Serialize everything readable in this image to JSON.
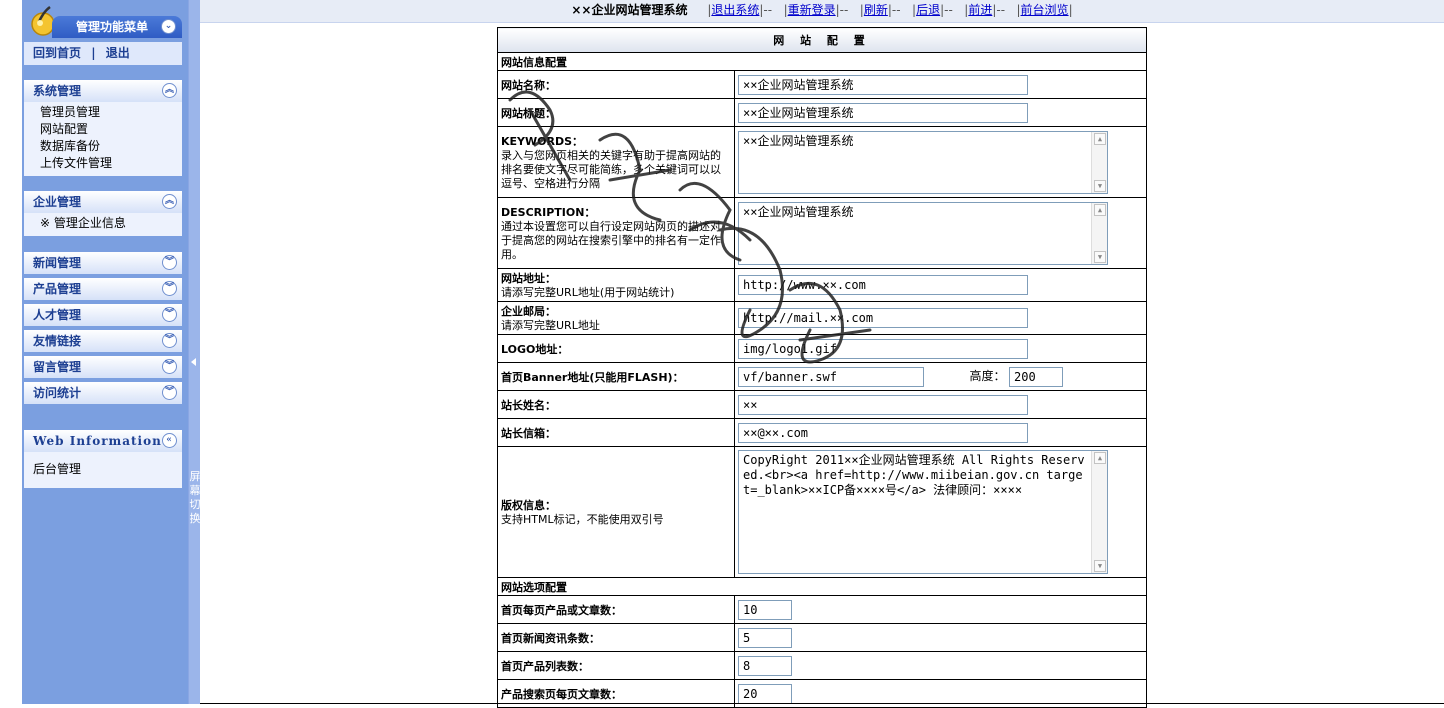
{
  "topbar": {
    "title": "××企业网站管理系统",
    "links": [
      "退出系统",
      "重新登录",
      "刷新",
      "后退",
      "前进",
      "前台浏览"
    ]
  },
  "sidebar": {
    "header": "管理功能菜单",
    "home": "回到首页",
    "logout": "退出",
    "panels": [
      {
        "title": "系统管理",
        "items": [
          "管理员管理",
          "网站配置",
          "数据库备份",
          "上传文件管理"
        ]
      },
      {
        "title": "企业管理",
        "items": [
          "※ 管理企业信息"
        ]
      },
      {
        "title": "新闻管理"
      },
      {
        "title": "产品管理"
      },
      {
        "title": "人才管理"
      },
      {
        "title": "友情链接"
      },
      {
        "title": "留言管理"
      },
      {
        "title": "访问统计"
      }
    ],
    "webinfo": {
      "title": "Web Information",
      "body": "后台管理"
    },
    "splitter_text": "屏幕切换"
  },
  "config": {
    "title": "网 站 配 置",
    "section1": "网站信息配置",
    "section2": "网站选项配置",
    "rows": {
      "site_name": {
        "label": "网站名称：",
        "value": "××企业网站管理系统"
      },
      "site_title": {
        "label": "网站标题：",
        "value": "××企业网站管理系统"
      },
      "keywords": {
        "label": "KEYWORDS：",
        "desc": "录入与您网页相关的关键字有助于提高网站的排名要使文字尽可能简练，多个关键词可以以逗号、空格进行分隔",
        "value": "××企业网站管理系统"
      },
      "description": {
        "label": "DESCRIPTION：",
        "desc": "通过本设置您可以自行设定网站网页的描述对于提高您的网站在搜索引擎中的排名有一定作用。",
        "value": "××企业网站管理系统"
      },
      "site_url": {
        "label": "网站地址：",
        "desc": "请添写完整URL地址(用于网站统计)",
        "value": "http://www.××.com"
      },
      "mail": {
        "label": "企业邮局：",
        "desc": "请添写完整URL地址",
        "value": "http://mail.××.com"
      },
      "logo": {
        "label": "LOGO地址：",
        "value": "img/logo1.gif"
      },
      "banner": {
        "label": "首页Banner地址(只能用FLASH)：",
        "value": "vf/banner.swf",
        "height_label": "高度：",
        "height_value": "200"
      },
      "owner_name": {
        "label": "站长姓名：",
        "value": "××"
      },
      "owner_mail": {
        "label": "站长信箱：",
        "value": "××@××.com"
      },
      "copyright": {
        "label": "版权信息：",
        "desc": "支持HTML标记，不能使用双引号",
        "value": "CopyRight 2011××企业网站管理系统 All Rights Reserved.<br><a href=http://www.miibeian.gov.cn target=_blank>××ICP备××××号</a> 法律顾问：××××"
      },
      "home_products": {
        "label": "首页每页产品或文章数：",
        "value": "10"
      },
      "home_news": {
        "label": "首页新闻资讯条数：",
        "value": "5"
      },
      "home_product_list": {
        "label": "首页产品列表数：",
        "value": "8"
      },
      "search_per_page": {
        "label": "产品搜索页每页文章数：",
        "value": "20"
      }
    }
  },
  "colors": {
    "sidebar": "#7b9fe0",
    "menu_header": "#3a66cc",
    "panel_text": "#1d3f92"
  },
  "icons": [
    "logo-icon",
    "collapse-icon",
    "expand-icon"
  ]
}
